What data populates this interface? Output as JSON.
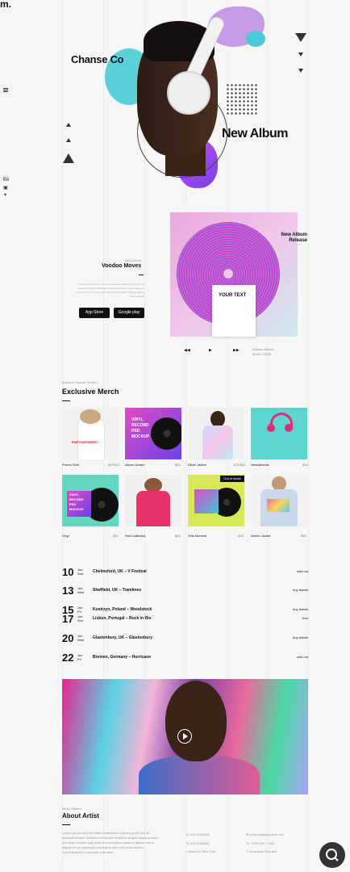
{
  "brand": {
    "logo": "m."
  },
  "hero": {
    "artist": "Chanse Co",
    "album": "New Album"
  },
  "album": {
    "eyebrow": "New Album",
    "title": "Voodoo Moves",
    "description": "Lorem ipsum dolor sit amet consectetur adipiscing elit sed do eiusmod tempor incididunt ut labore et dolore magna aliqua ut enim ad minim veniam quis nostrud exercitation ullamco laboris nisi ut aliquip",
    "appstore": "App Store",
    "googleplay": "Google play",
    "cover_text": "New Album Release",
    "card_text": "YOUR TEXT",
    "track": "Voodoo Moves",
    "track_sub": "00:00 / 03:25"
  },
  "merch": {
    "eyebrow": "Madison Square Garden",
    "title": "Exclusive Merch",
    "items": [
      {
        "name": "Promo Shirt",
        "price": "$49 $20"
      },
      {
        "name": "Album Dream",
        "price": "$35"
      },
      {
        "name": "Silver Jacket",
        "price": "$75 $52"
      },
      {
        "name": "Headphones",
        "price": "$26"
      },
      {
        "name": "Vinyl",
        "price": "$30"
      },
      {
        "name": "Red California",
        "price": "$35"
      },
      {
        "name": "This Moment",
        "price": "$45"
      },
      {
        "name": "Denim Jacket",
        "price": "$65"
      }
    ],
    "vinyl_lines": [
      "VINYL",
      "RECORD",
      "PSD",
      "MOCKUP"
    ],
    "badge_text": "Out of stock",
    "shirt_text": "EMPOWERMENT"
  },
  "events": [
    {
      "day": "10",
      "month": "Jun",
      "weekday": "Sun",
      "name": "Chelmsford, UK – V Festival",
      "status": "sold out"
    },
    {
      "day": "13",
      "month": "Jun",
      "weekday": "Wed",
      "name": "Sheffield, UK – Tramlines",
      "status": "buy tickets"
    },
    {
      "day": "15",
      "month": "Jun",
      "weekday": "Fri",
      "name": "Kostrzyn, Poland – Woodstock",
      "status": "buy tickets"
    },
    {
      "day": "17",
      "month": "Jun",
      "weekday": "Sun",
      "name": "Lisbon, Portugal – Rock in Rio",
      "status": "free"
    },
    {
      "day": "20",
      "month": "Jun",
      "weekday": "Wed",
      "name": "Glastonbury, UK – Glastonbury",
      "status": "buy tickets"
    },
    {
      "day": "22",
      "month": "Jun",
      "weekday": "Fri",
      "name": "Bremen, Germany – Hurricane",
      "status": "sold out"
    }
  ],
  "about": {
    "eyebrow": "Music Makers",
    "title": "About Artist",
    "text": "Lorem ipsum dolor sit amet consectetur adipiscing elit sed do eiusmod tempor incididunt ut labore et dolore magna aliqua ut enim ad minim veniam quis nostrud exercitation ullamco laboris nisi ut aliquip ex ea commodo consequat duis aute irure dolor in reprehenderit in voluptate velit esse.",
    "contacts": [
      "000-0000000",
      "000-0000000",
      "Based in New York",
      "yourmail@example.com",
      "+000 000 - 0000",
      "Download Resume"
    ]
  },
  "colors": {
    "accent": "#7b3ff2",
    "pink": "#e04fc6",
    "teal": "#4dd6da",
    "dark": "#111111"
  }
}
